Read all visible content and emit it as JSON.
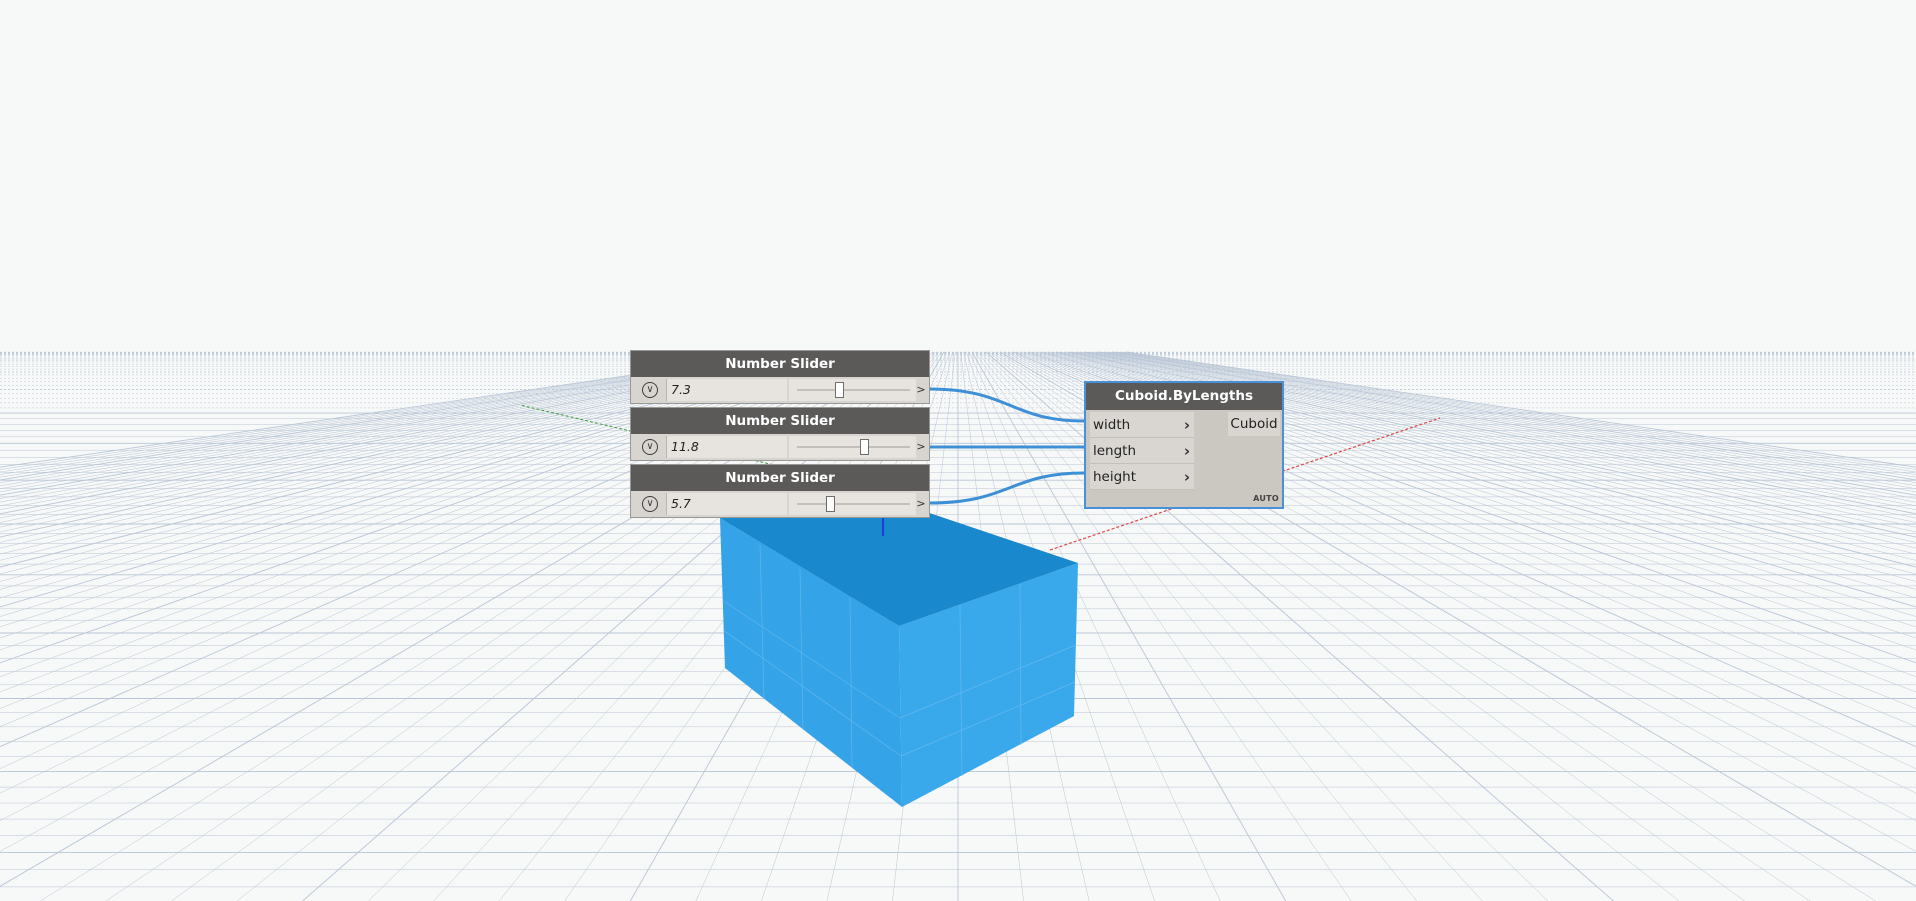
{
  "canvas": {
    "background": "#f7f8f8",
    "grid_color": "#b9c6d6",
    "x_axis_color": "#e04444",
    "y_axis_color": "#3a9a3a",
    "z_axis_color": "#2222dd"
  },
  "geometry": {
    "cuboid_color_side": "#38a6ea",
    "cuboid_color_top": "#1a88cc"
  },
  "nodes": {
    "slider_width": {
      "title": "Number Slider",
      "value": "7.3",
      "position_fraction": 0.37,
      "expander_icon": "chevron-down-icon",
      "step_label": ">"
    },
    "slider_length": {
      "title": "Number Slider",
      "value": "11.8",
      "position_fraction": 0.59,
      "expander_icon": "chevron-down-icon",
      "step_label": ">"
    },
    "slider_height": {
      "title": "Number Slider",
      "value": "5.7",
      "position_fraction": 0.29,
      "expander_icon": "chevron-down-icon",
      "step_label": ">"
    },
    "cuboid": {
      "title": "Cuboid.ByLengths",
      "inputs": [
        {
          "label": "width"
        },
        {
          "label": "length"
        },
        {
          "label": "height"
        }
      ],
      "output": "Cuboid",
      "lacing": "AUTO",
      "selected_border": "#4a90d9"
    }
  },
  "wires": {
    "color": "#3d8fd6"
  }
}
